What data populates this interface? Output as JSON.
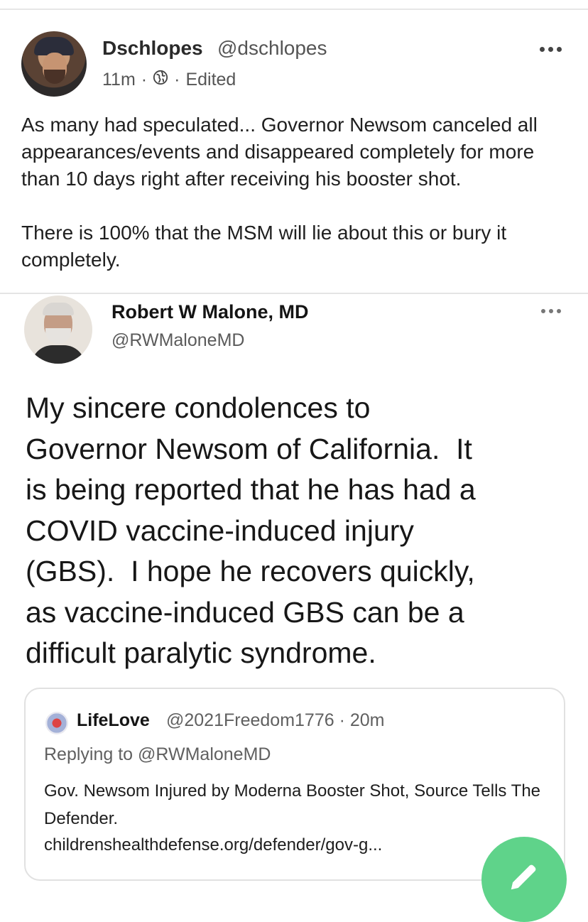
{
  "post": {
    "display_name": "Dschlopes",
    "handle": "@dschlopes",
    "time": "11m",
    "separator": "·",
    "visibility_icon": "globe-icon",
    "edited": "Edited",
    "more_icon": "more-horizontal-icon",
    "text_paragraph_1": "As many had speculated... Governor Newsom canceled all appearances/events and disappeared completely for more than 10 days right after receiving his booster shot.",
    "text_paragraph_2": "There is 100% that the MSM will lie about this or bury it completely."
  },
  "embedded_tweet": {
    "name": "Robert W Malone, MD",
    "handle": "@RWMaloneMD",
    "more_icon": "more-horizontal-icon",
    "body_lines": [
      "My sincere condolences to",
      "Governor Newsom of California.  It",
      "is being reported that he has had a",
      "COVID vaccine-induced injury",
      "(GBS).  I hope he recovers quickly,",
      "as vaccine-induced GBS can be a",
      "difficult paralytic syndrome."
    ],
    "quoted": {
      "name": "LifeLove",
      "handle_time": "@2021Freedom1776 · 20m",
      "replying_to": "Replying to @RWMaloneMD",
      "text": "Gov. Newsom Injured by Moderna Booster Shot, Source Tells The Defender.",
      "link": "childrenshealthdefense.org/defender/gov-g..."
    }
  },
  "compose_button": {
    "icon": "pencil-icon"
  },
  "colors": {
    "fab": "#5fd38a",
    "text": "#1c1c1c",
    "muted": "#555555",
    "divider": "#e4e4e4"
  }
}
